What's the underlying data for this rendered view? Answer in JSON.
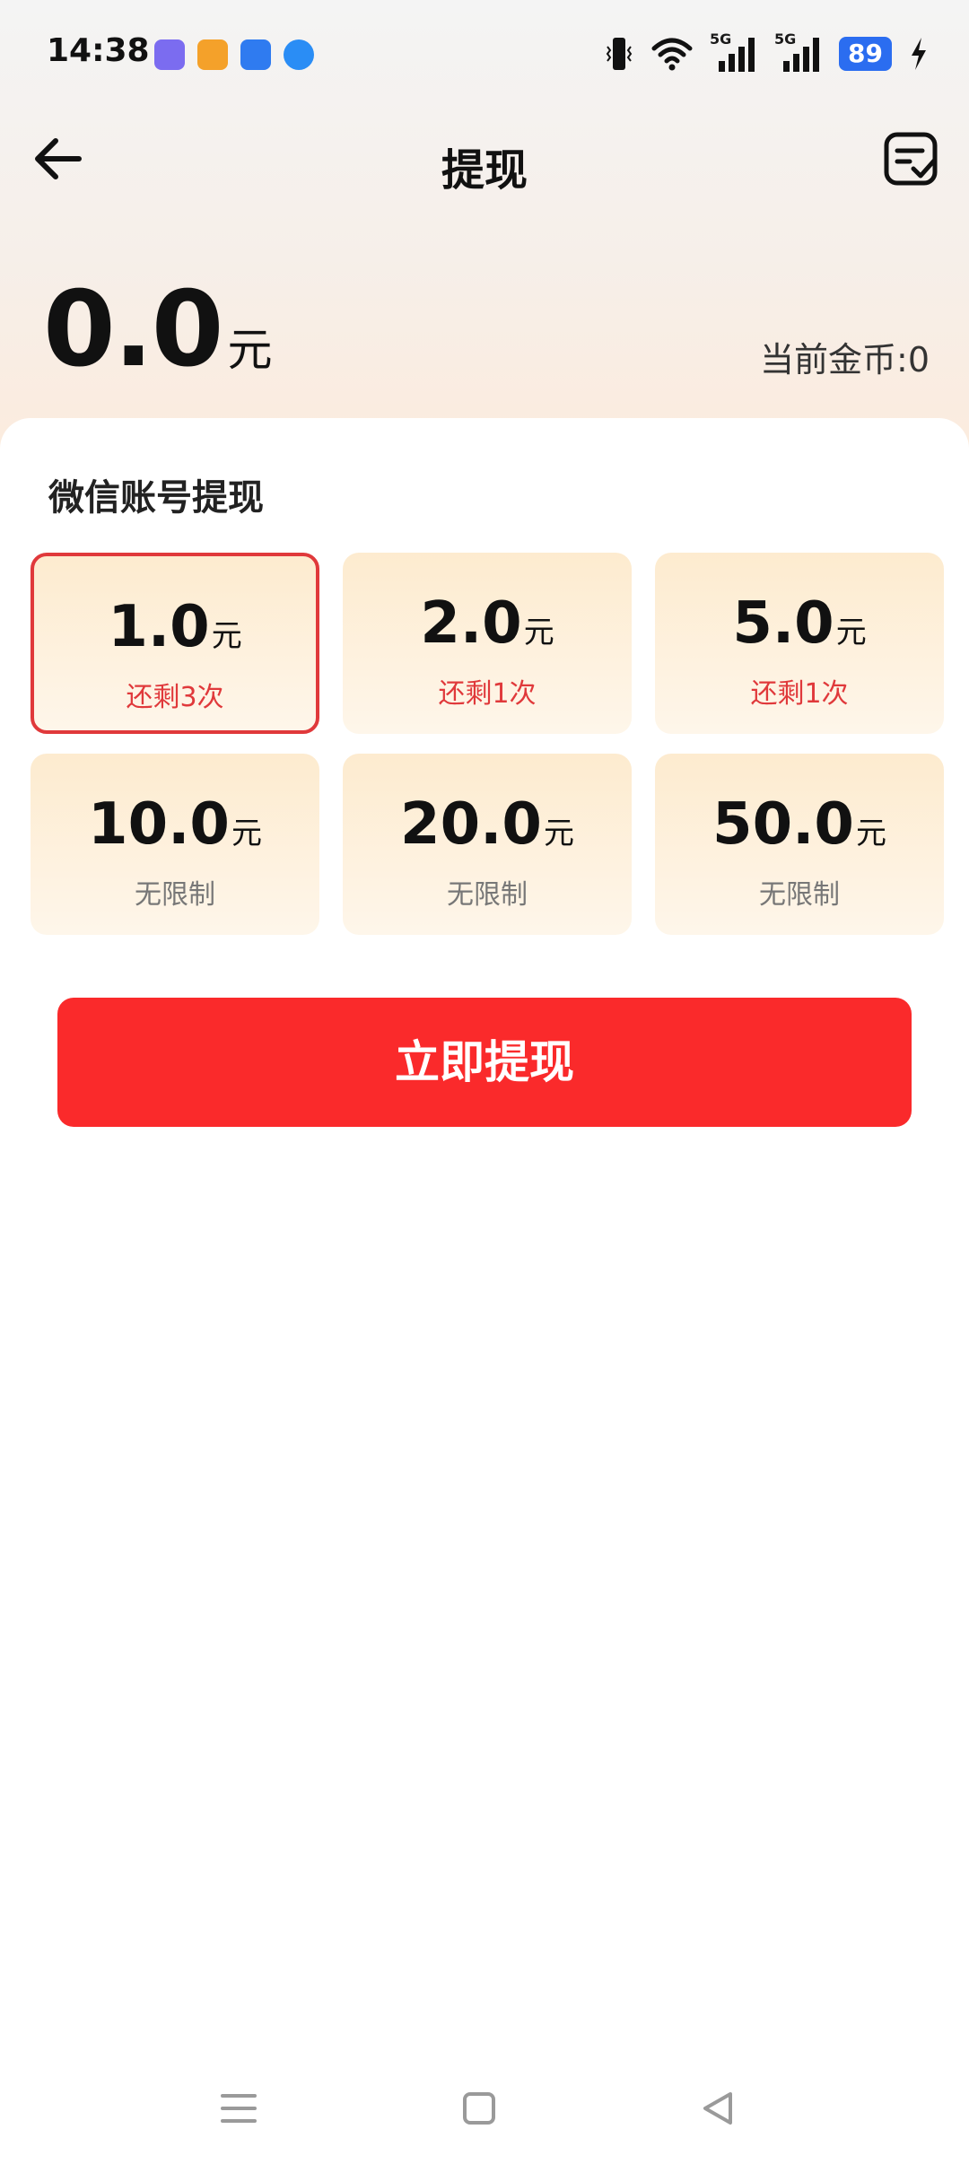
{
  "status_bar": {
    "time": "14:38",
    "network_left": "5G",
    "network_right": "5G",
    "battery": "89"
  },
  "nav": {
    "title": "提现"
  },
  "balance": {
    "amount": "0.0",
    "unit": "元",
    "coins_label": "当前金币:0"
  },
  "section": {
    "title": "微信账号提现"
  },
  "options": [
    {
      "amount": "1.0",
      "unit": "元",
      "sub": "还剩3次",
      "selected": true
    },
    {
      "amount": "2.0",
      "unit": "元",
      "sub": "还剩1次",
      "selected": false
    },
    {
      "amount": "5.0",
      "unit": "元",
      "sub": "还剩1次",
      "selected": false
    },
    {
      "amount": "10.0",
      "unit": "元",
      "sub": "无限制",
      "selected": false
    },
    {
      "amount": "20.0",
      "unit": "元",
      "sub": "无限制",
      "selected": false
    },
    {
      "amount": "50.0",
      "unit": "元",
      "sub": "无限制",
      "selected": false
    }
  ],
  "actions": {
    "withdraw_label": "立即提现"
  },
  "colors": {
    "accent_red": "#fa2a2b",
    "selected_border": "#e0393b",
    "battery_blue": "#2b6df0"
  }
}
